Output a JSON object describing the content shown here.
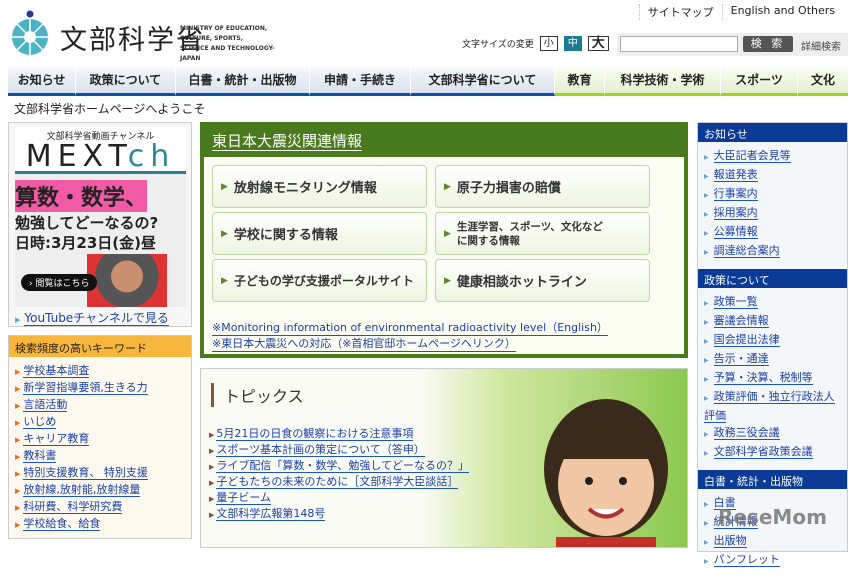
{
  "header": {
    "logo_ja": "文部科学省",
    "logo_en": [
      "MINISTRY OF EDUCATION,",
      "CULTURE, SPORTS,",
      "SCIENCE AND TECHNOLOGY-JAPAN"
    ],
    "top_links": [
      "サイトマップ",
      "English and Others"
    ],
    "font_size_label": "文字サイズの変更",
    "font_sizes": [
      "小",
      "中",
      "大"
    ],
    "search_placeholder": "",
    "search_button": "検 索",
    "advanced_search": "詳細検索"
  },
  "nav": [
    "お知らせ",
    "政策について",
    "白書・統計・出版物",
    "申請・手続き",
    "文部科学省について",
    "教育",
    "科学技術・学術",
    "スポーツ",
    "文化"
  ],
  "welcome": "文部科学省ホームページへようこそ",
  "video": {
    "subtitle": "文部科学省動画チャンネル",
    "title_main": "MEXT",
    "title_ch": "ch",
    "line1": "算数・数学、",
    "line2": "勉強してどーなるの?",
    "line3": "日時:3月23日(金)昼",
    "view_button": "閲覧はこちら",
    "youtube_link": "YouTubeチャンネルで見る"
  },
  "keywords": {
    "title": "検索頻度の高いキーワード",
    "items": [
      "学校基本調査",
      "新学習指導要領,生きる力",
      "言語活動",
      "いじめ",
      "キャリア教育",
      "教科書",
      "特別支援教育、 特別支援",
      "放射線,放射能,放射線量",
      "科研費、科学研究費",
      "学校給食、給食"
    ]
  },
  "quake": {
    "title": "東日本大震災関連情報",
    "buttons": [
      "放射線モニタリング情報",
      "原子力損害の賠償",
      "学校に関する情報",
      "生涯学習、スポーツ、文化などに関する情報",
      "子どもの学び支援ポータルサイト",
      "健康相談ホットライン"
    ],
    "links": [
      "※Monitoring information of environmental radioactivity level（English）",
      "※東日本大震災への対応（※首相官邸ホームページへリンク）"
    ]
  },
  "topics": {
    "title": "トピックス",
    "items": [
      "5月21日の日食の観察における注意事項",
      "スポーツ基本計画の策定について（答申）",
      "ライブ配信「算数・数学、勉強してどーなるの？」",
      "子どもたちの未来のために［文部科学大臣談話］",
      "量子ビーム",
      "文部科学広報第148号"
    ]
  },
  "right": {
    "sections": [
      {
        "title": "お知らせ",
        "items": [
          "大臣記者会見等",
          "報道発表",
          "行事案内",
          "採用案内",
          "公募情報",
          "調達総合案内"
        ]
      },
      {
        "title": "政策について",
        "items": [
          "政策一覧",
          "審議会情報",
          "国会提出法律",
          "告示・通達",
          "予算・決算、税制等",
          "政策評価・独立行政法人評価",
          "政務三役会議",
          "文部科学省政策会議"
        ]
      },
      {
        "title": "白書・統計・出版物",
        "items": [
          "白書",
          "統計情報",
          "出版物",
          "パンフレット"
        ]
      }
    ]
  },
  "watermark": "ReseMom"
}
